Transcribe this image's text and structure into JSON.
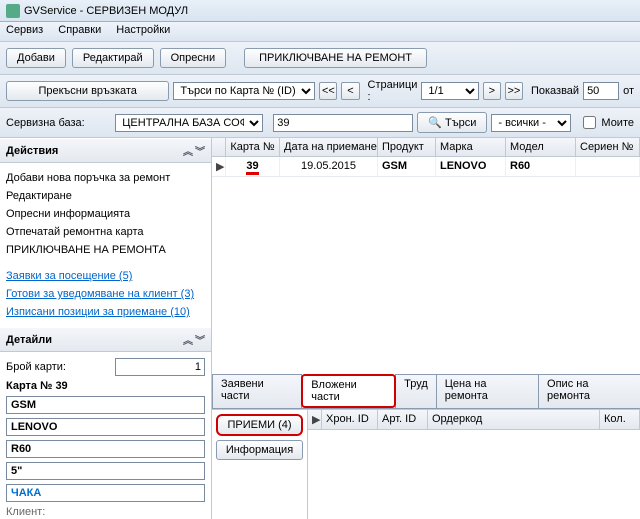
{
  "title": "GVService - СЕРВИЗЕН МОДУЛ",
  "menu": {
    "service": "Сервиз",
    "reports": "Справки",
    "settings": "Настройки"
  },
  "toolbar": {
    "add": "Добави",
    "edit": "Редактирай",
    "refresh": "Опресни",
    "close_repair": "ПРИКЛЮЧВАНЕ НА РЕМОНТ"
  },
  "searchbar": {
    "disconnect": "Прекъсни връзката",
    "search_by": "Търси по Карта № (ID)",
    "pages_label": "Страници :",
    "pages": "1/1",
    "show_label": "Показвай",
    "show": "50",
    "from": "от"
  },
  "row2": {
    "base_label": "Сервизна база:",
    "base": "ЦЕНТРАЛНА БАЗА СОФИЯ",
    "search_value": "39",
    "search_btn": "Търси",
    "filter": "- всички -",
    "mine": "Моите"
  },
  "actions": {
    "title": "Действия",
    "a1": "Добави нова поръчка за ремонт",
    "a2": "Редактиране",
    "a3": "Опресни информацията",
    "a4": "Отпечатай ремонтна карта",
    "a5": "ПРИКЛЮЧВАНЕ НА РЕМОНТА",
    "l1": "Заявки за посещение (5)",
    "l2": "Готови за уведомяване на клиент (3)",
    "l3": "Изписани позиции за приемане (10)"
  },
  "details": {
    "title": "Детайли",
    "count_label": "Брой карти:",
    "count": "1",
    "card_label": "Карта №",
    "card": "39",
    "f_product": "GSM",
    "f_brand": "LENOVO",
    "f_model": "R60",
    "f_size": "5\"",
    "f_status": "ЧАКА",
    "client": "Клиент:"
  },
  "grid": {
    "h_card": "Карта №",
    "h_date": "Дата на приемане",
    "h_product": "Продукт",
    "h_brand": "Марка",
    "h_model": "Модел",
    "h_serial": "Сериен №",
    "row": {
      "card": "39",
      "date": "19.05.2015",
      "product": "GSM",
      "brand": "LENOVO",
      "model": "R60"
    }
  },
  "tabs": {
    "t1": "Заявени части",
    "t2": "Вложени части",
    "t3": "Труд",
    "t4": "Цена на ремонта",
    "t5": "Опис на ремонта"
  },
  "sub": {
    "accept": "ПРИЕМИ (4)",
    "info": "Информация",
    "h_chron": "Хрон. ID",
    "h_art": "Арт. ID",
    "h_order": "Ордеркод",
    "h_qty": "Кол."
  }
}
